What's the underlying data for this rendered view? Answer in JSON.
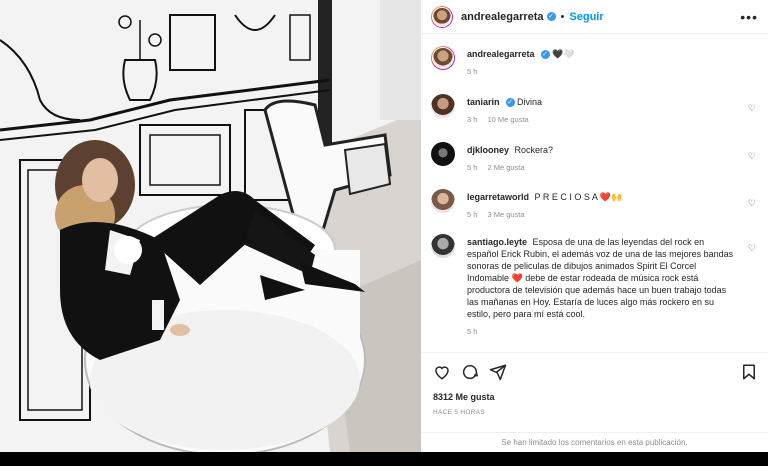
{
  "header": {
    "username": "andrealegarreta",
    "follow_label": "Seguir",
    "dot": "•",
    "more": "•••"
  },
  "caption": {
    "username": "andrealegarreta",
    "text": "🖤🤍",
    "time": "5 h"
  },
  "comments": [
    {
      "username": "taniarin",
      "text": "Divina",
      "time": "3 h",
      "likes": "10 Me gusta"
    },
    {
      "username": "djklooney",
      "text": "Rockera?",
      "time": "5 h",
      "likes": "2 Me gusta"
    },
    {
      "username": "legarretaworld",
      "text": "P R E C I O S A ❤️🙌",
      "time": "5 h",
      "likes": "3 Me gusta"
    },
    {
      "username": "santiago.leyte",
      "text": "Esposa de una de las leyendas del rock en español Erick Rubin, el además voz de una de las mejores bandas sonoras de peliculas de dibujos animados Spirit El Corcel Indomable ❤️ debe de estar rodeada de música rock está productora de televisión que además hace un buen trabajo todas las mañanas en Hoy. Estaría de luces algo más rockero en su estilo, pero para mí está cool.",
      "time": "5 h",
      "likes": ""
    }
  ],
  "actions": {
    "likes": "8312 Me gusta",
    "time": "HACE 5 HORAS"
  },
  "footer": {
    "limited": "Se han limitado los comentarios en esta publicación."
  },
  "colors": {
    "accent": "#0095f6",
    "verified": "#3897f0",
    "heart": "#ed4956"
  }
}
